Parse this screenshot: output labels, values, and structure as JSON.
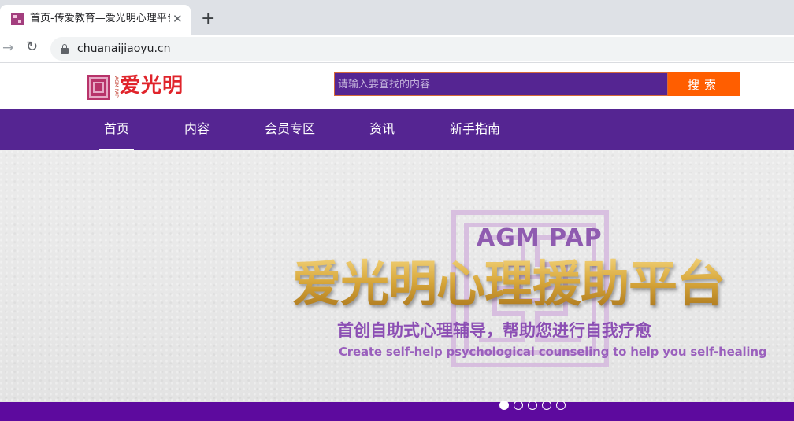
{
  "browser": {
    "tab_title": "首页-传爱教育—爱光明心理平台",
    "tab_close": "✕",
    "new_tab": "+",
    "url": "chuanaijiaoyu.cn"
  },
  "header": {
    "logo_text": "爱光明",
    "logo_sub": "AGM PAP",
    "search_placeholder": "请输入要查找的内容",
    "search_button": "搜索"
  },
  "nav": {
    "items": [
      "首页",
      "内容",
      "会员专区",
      "资讯",
      "新手指南"
    ],
    "active_index": 0
  },
  "banner": {
    "acronym": "AGM PAP",
    "title": "爱光明心理援助平台",
    "subtitle": "首创自助式心理辅导，帮助您进行自我疗愈",
    "subtitle_en": "Create self-help psychological counseling to help you self-healing",
    "slide_count": 5,
    "active_slide": 0
  },
  "colors": {
    "brand_purple": "#552592",
    "search_button": "#ff5e00",
    "logo_red": "#e0242b",
    "banner_gold": "#c99425",
    "banner_purple": "#8c4fb4",
    "bottom_bar": "#5d0a9e"
  }
}
